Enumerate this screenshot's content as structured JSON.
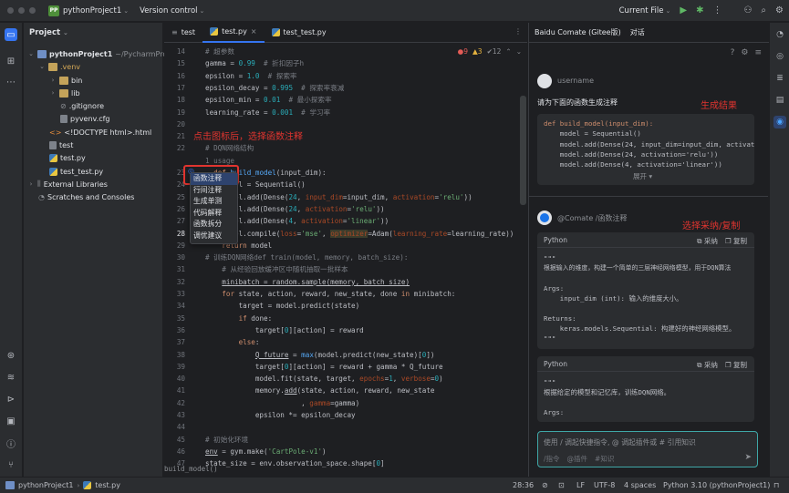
{
  "titlebar": {
    "project_badge": "PP",
    "project_name": "pythonProject1",
    "version_control": "Version control",
    "run_config": "Current File"
  },
  "project_panel": {
    "title": "Project",
    "tree": [
      {
        "label": "pythonProject1",
        "suffix": "~/PycharmProje"
      },
      {
        "label": ".venv"
      },
      {
        "label": "bin"
      },
      {
        "label": "lib"
      },
      {
        "label": ".gitignore"
      },
      {
        "label": "pyvenv.cfg"
      },
      {
        "label": "<!DOCTYPE html>.html"
      },
      {
        "label": "test"
      },
      {
        "label": "test.py"
      },
      {
        "label": "test_test.py"
      },
      {
        "label": "External Libraries"
      },
      {
        "label": "Scratches and Consoles"
      }
    ]
  },
  "editor": {
    "tabs": [
      "test",
      "test.py",
      "test_test.py"
    ],
    "inspections": {
      "errors": "9",
      "warnings": "3",
      "weak": "12"
    },
    "usage_hint": "1 usage",
    "breadcrumb": "build_model()",
    "line_numbers": [
      "14",
      "15",
      "16",
      "17",
      "18",
      "19",
      "20",
      "21",
      "22",
      "",
      "23",
      "24",
      "25",
      "26",
      "27",
      "28",
      "29",
      "30",
      "31",
      "32",
      "33",
      "34",
      "35",
      "36",
      "37",
      "38",
      "39",
      "40",
      "41",
      "42",
      "43",
      "44",
      "45",
      "46",
      "47"
    ],
    "context_menu": [
      "函数注释",
      "行间注释",
      "生成单测",
      "代码解释",
      "函数拆分",
      "调优建议"
    ],
    "annotation": "点击图标后，选择函数注释"
  },
  "comate": {
    "title": "Baidu Comate (Gitee版)",
    "tab2": "对话",
    "username": "username",
    "prompt": "请为下面的函数生成注释",
    "result_annotation": "生成结果",
    "code_lines": [
      "def build_model(input_dim):",
      "    model = Sequential()",
      "    model.add(Dense(24, input_dim=input_dim, activatio",
      "    model.add(Dense(24, activation='relu'))",
      "    model.add(Dense(4, activation='linear'))"
    ],
    "expand": "展开",
    "reply_sender": "@Comate",
    "reply_cmd": "/函数注释",
    "reply_annotation": "选择采纳/复制",
    "block1": {
      "lang": "Python",
      "adopt": "采纳",
      "copy": "复制",
      "lines": [
        "\"\"\"",
        "根据输入的维度，构建一个简单的三层神经网络模型，用于DQN算法",
        "",
        "Args:",
        "    input_dim (int): 输入的维度大小。",
        "",
        "Returns:",
        "    keras.models.Sequential: 构建好的神经网络模型。",
        "\"\"\""
      ]
    },
    "block2": {
      "lang": "Python",
      "adopt": "采纳",
      "copy": "复制",
      "lines": [
        "\"\"\"",
        "根据给定的模型和记忆库，训练DQN网络。",
        "",
        "Args:"
      ]
    },
    "input_placeholder": "使用 / 调起快捷指令, @ 调起插件或 # 引用知识",
    "input_hints": [
      "/指令",
      "@插件",
      "#知识"
    ]
  },
  "statusbar": {
    "crumb1": "pythonProject1",
    "crumb2": "test.py",
    "position": "28:36",
    "line_sep": "LF",
    "encoding": "UTF-8",
    "indent": "4 spaces",
    "interpreter": "Python 3.10 (pythonProject1)"
  }
}
